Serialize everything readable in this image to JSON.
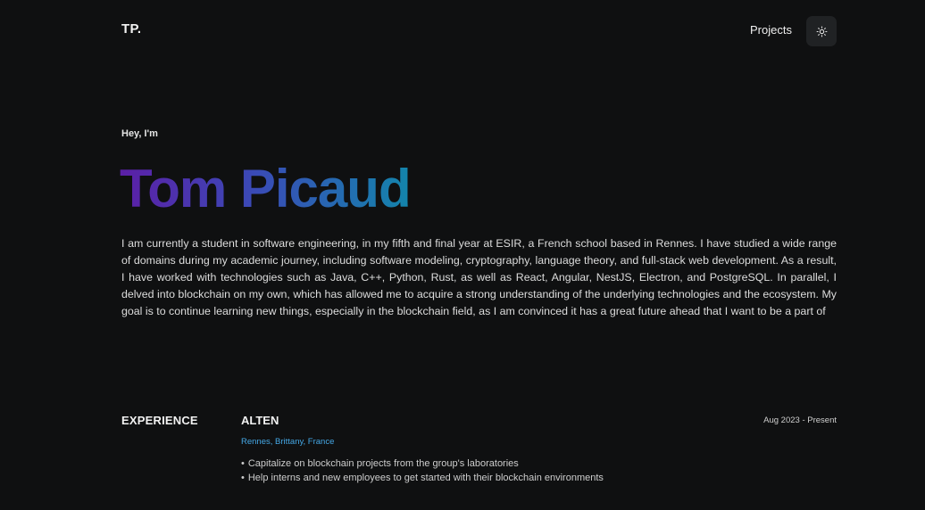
{
  "header": {
    "logo": "TP.",
    "nav": {
      "projects_label": "Projects"
    },
    "theme_toggle_icon": "sun-icon"
  },
  "hero": {
    "greeting": "Hey, I'm",
    "name": "Tom Picaud",
    "name_gradient": [
      "#5b1fa6",
      "#3b49b6",
      "#1385ac"
    ],
    "bio": "I am currently a student in software engineering, in my fifth and final year at ESIR, a French school based in Rennes. I have studied a wide range of domains during my academic journey, including software modeling, cryptography, language theory, and full-stack web development. As a result, I have worked with technologies such as Java, C++, Python, Rust, as well as React, Angular, NestJS, Electron, and PostgreSQL. In parallel, I delved into blockchain on my own, which has allowed me to acquire a strong understanding of the underlying technologies and the ecosystem. My goal is to continue learning new things, especially in the blockchain field, as I am convinced it has a great future ahead that I want to be a part of"
  },
  "experience": {
    "section_title": "EXPERIENCE",
    "items": [
      {
        "company": "ALTEN",
        "dates": "Aug 2023 - Present",
        "location": "Rennes, Brittany, France",
        "tasks": [
          "Capitalize on blockchain projects from the group's laboratories",
          "Help interns and new employees to get started with their blockchain environments"
        ]
      }
    ]
  },
  "colors": {
    "background": "#0f1011",
    "accent_link": "#45a8e6",
    "button_bg": "#202224"
  }
}
